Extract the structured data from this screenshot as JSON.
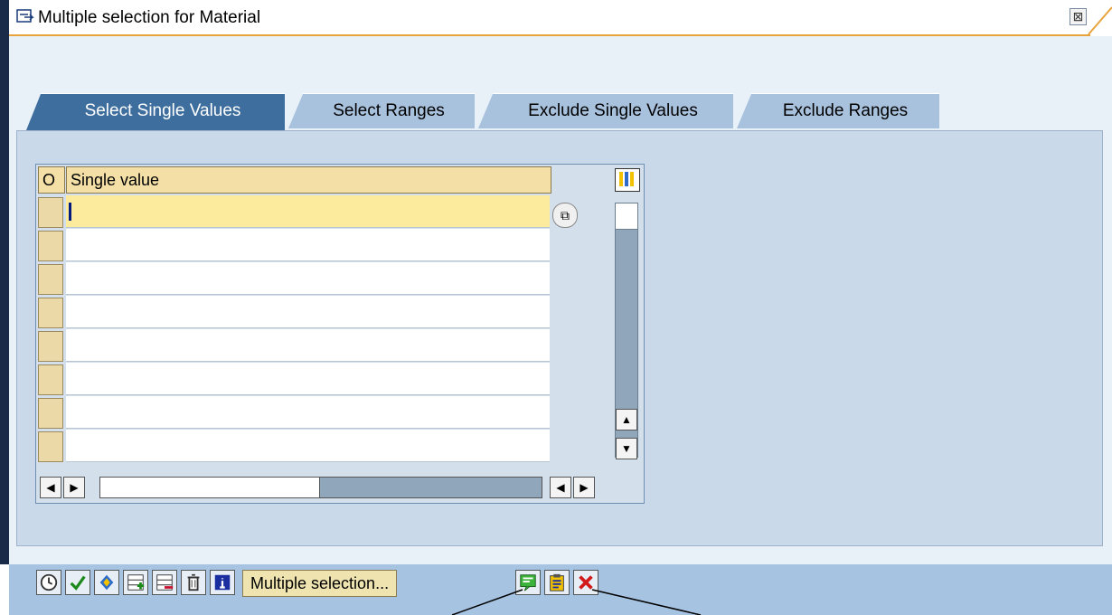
{
  "window": {
    "title": "Multiple selection for Material",
    "close_symbol": "⊠"
  },
  "tabs": [
    {
      "label": "Select Single Values",
      "active": true
    },
    {
      "label": "Select Ranges",
      "active": false
    },
    {
      "label": "Exclude Single Values",
      "active": false
    },
    {
      "label": "Exclude Ranges",
      "active": false
    }
  ],
  "table": {
    "headers": {
      "option": "O",
      "value": "Single value"
    },
    "rows": [
      "",
      "",
      "",
      "",
      "",
      "",
      "",
      ""
    ]
  },
  "toolbar": {
    "icons": [
      "execute-icon",
      "check-icon",
      "import-icon",
      "insert-row-icon",
      "delete-row-icon",
      "delete-all-icon",
      "info-icon",
      "upload-icon",
      "clipboard-icon",
      "cancel-icon"
    ],
    "multiple_selection_label": "Multiple selection..."
  },
  "colors": {
    "tab_active": "#3e6e9e",
    "tab_inactive": "#a8c2de",
    "header": "#f4e0a6",
    "toolbar": "#a6c4e2",
    "title_underline": "#e8a33c"
  }
}
